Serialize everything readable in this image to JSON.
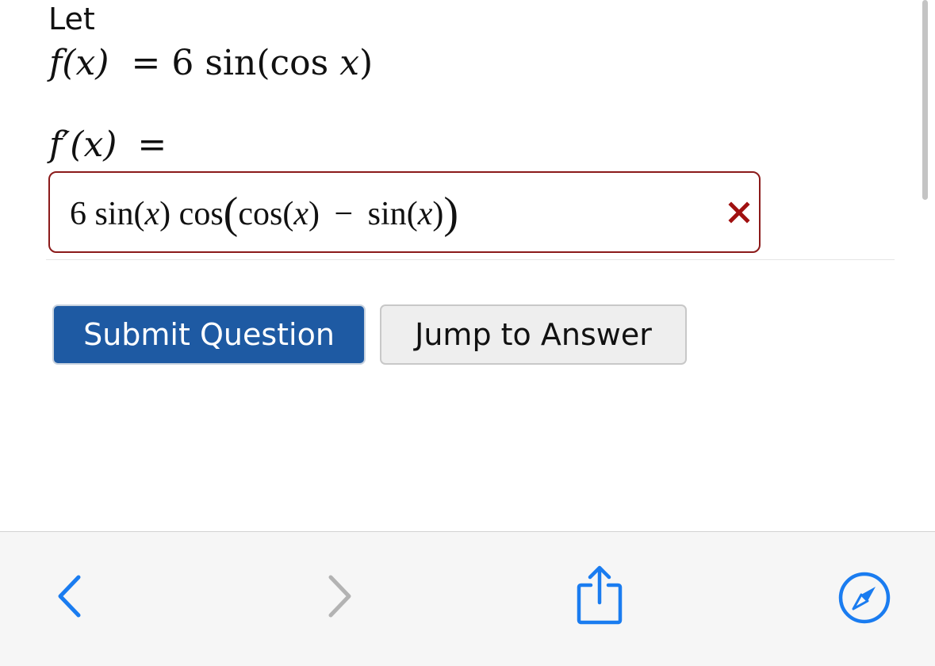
{
  "question": {
    "let_label": "Let",
    "function_lhs": "f(x)",
    "equals": "=",
    "function_coef": "6",
    "function_sin": "sin",
    "function_open": "(",
    "function_cos": "cos",
    "function_var": "x",
    "function_close": ")",
    "derivative_lhs": "f′(x)",
    "derivative_equals": "="
  },
  "answer": {
    "coef": "6",
    "sin1": "sin",
    "paren_open1": "(",
    "var1": "x",
    "paren_close1": ")",
    "cos1": "cos",
    "big_open": "(",
    "cos2": "cos",
    "paren_open2": "(",
    "var2": "x",
    "paren_close2": ")",
    "minus": "−",
    "sin2": "sin",
    "paren_open3": "(",
    "var3": "x",
    "paren_close3": ")",
    "big_close": ")",
    "status": "incorrect",
    "status_color": "#a01010"
  },
  "buttons": {
    "submit_label": "Submit Question",
    "jump_label": "Jump to Answer"
  },
  "toolbar": {
    "back_icon": "chevron-left-icon",
    "forward_icon": "chevron-right-icon",
    "share_icon": "share-icon",
    "safari_icon": "compass-icon",
    "accent_color": "#1a7cf0"
  }
}
